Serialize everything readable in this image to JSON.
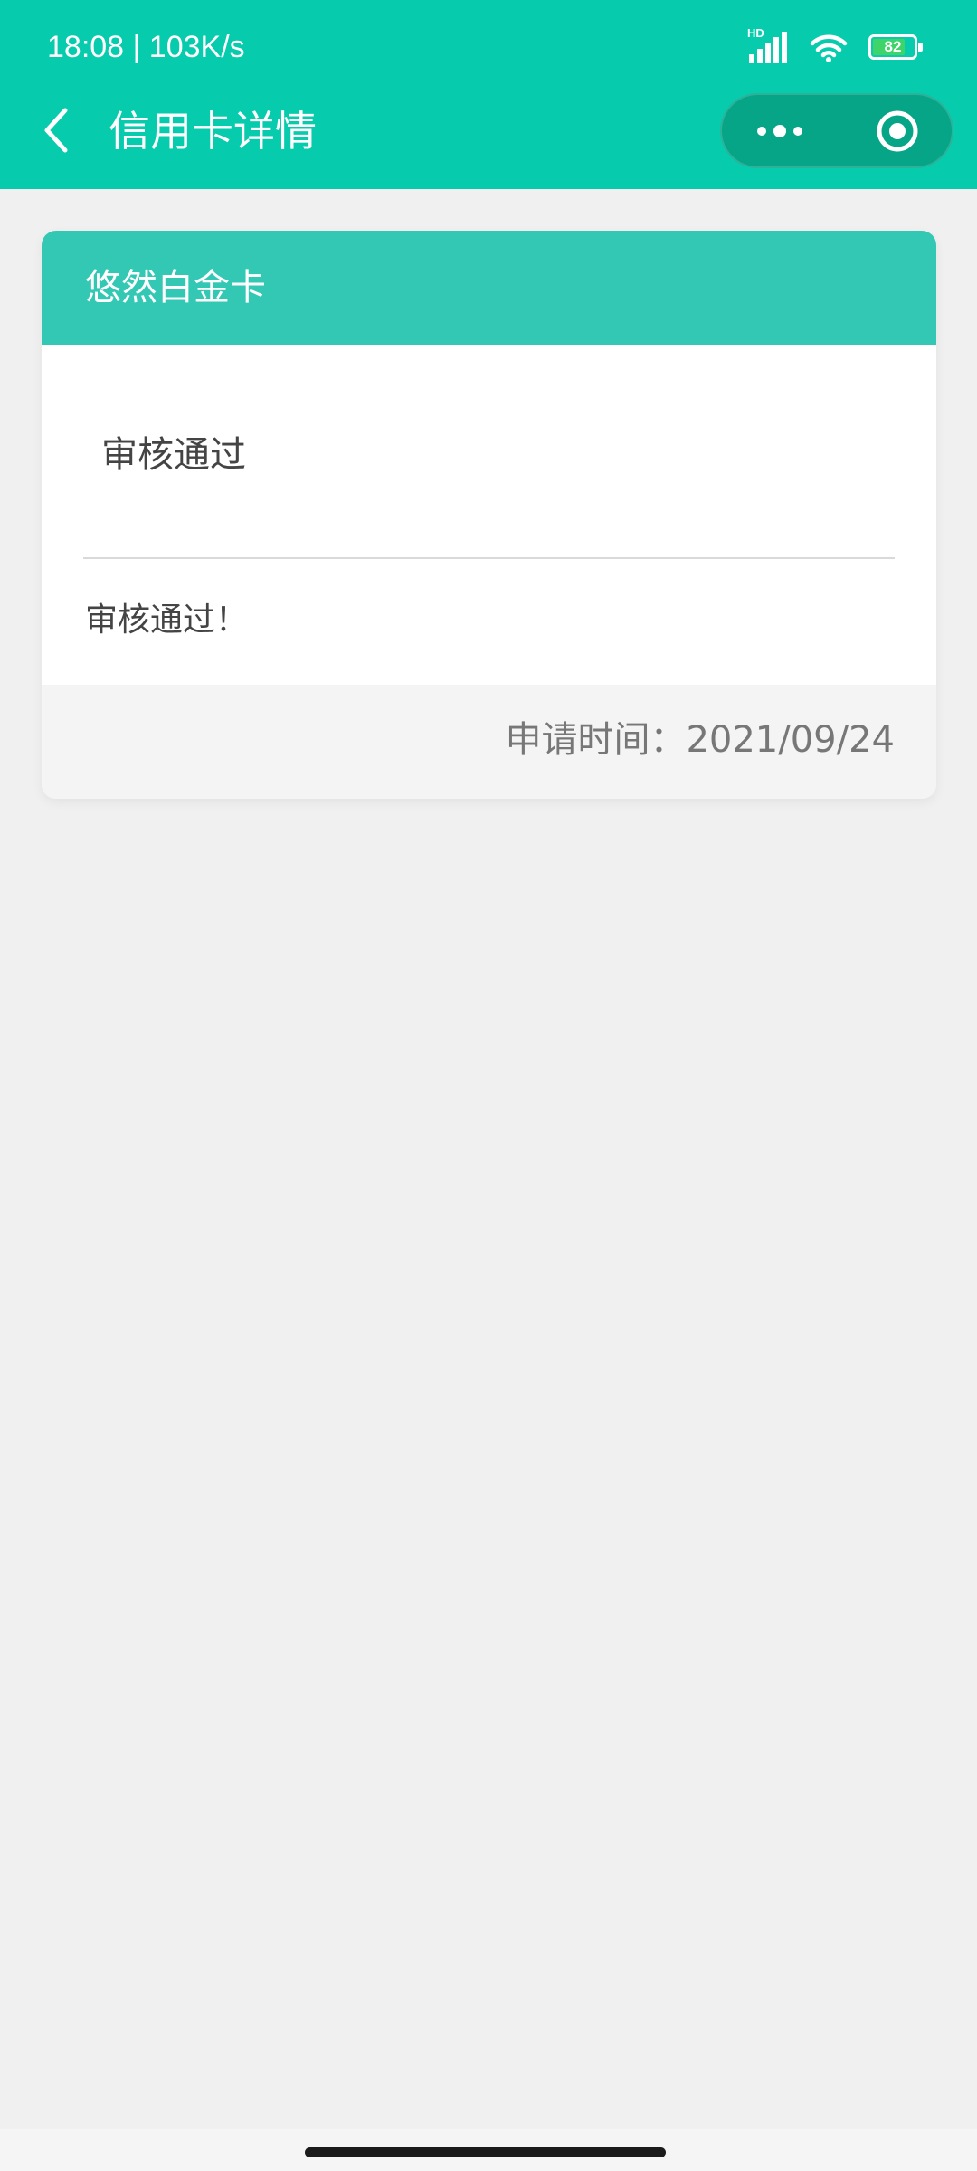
{
  "status_bar": {
    "time": "18:08 | 103K/s",
    "network_label": "HD",
    "battery_level": "82"
  },
  "nav": {
    "title": "信用卡详情"
  },
  "card": {
    "name": "悠然白金卡",
    "status": "审核通过",
    "message": "审核通过！",
    "apply_time_label": "申请时间：",
    "apply_time_value": "2021/09/24"
  },
  "icons": {
    "back": "chevron-left-icon",
    "more": "more-dots-icon",
    "close": "target-circle-icon",
    "signal": "signal-icon",
    "wifi": "wifi-icon",
    "battery": "battery-icon"
  },
  "colors": {
    "header": "#07cbad",
    "card_header": "#33c8b4",
    "capsule": "#06a588",
    "background": "#f0f0f0",
    "battery_fill": "#3fd46a"
  }
}
